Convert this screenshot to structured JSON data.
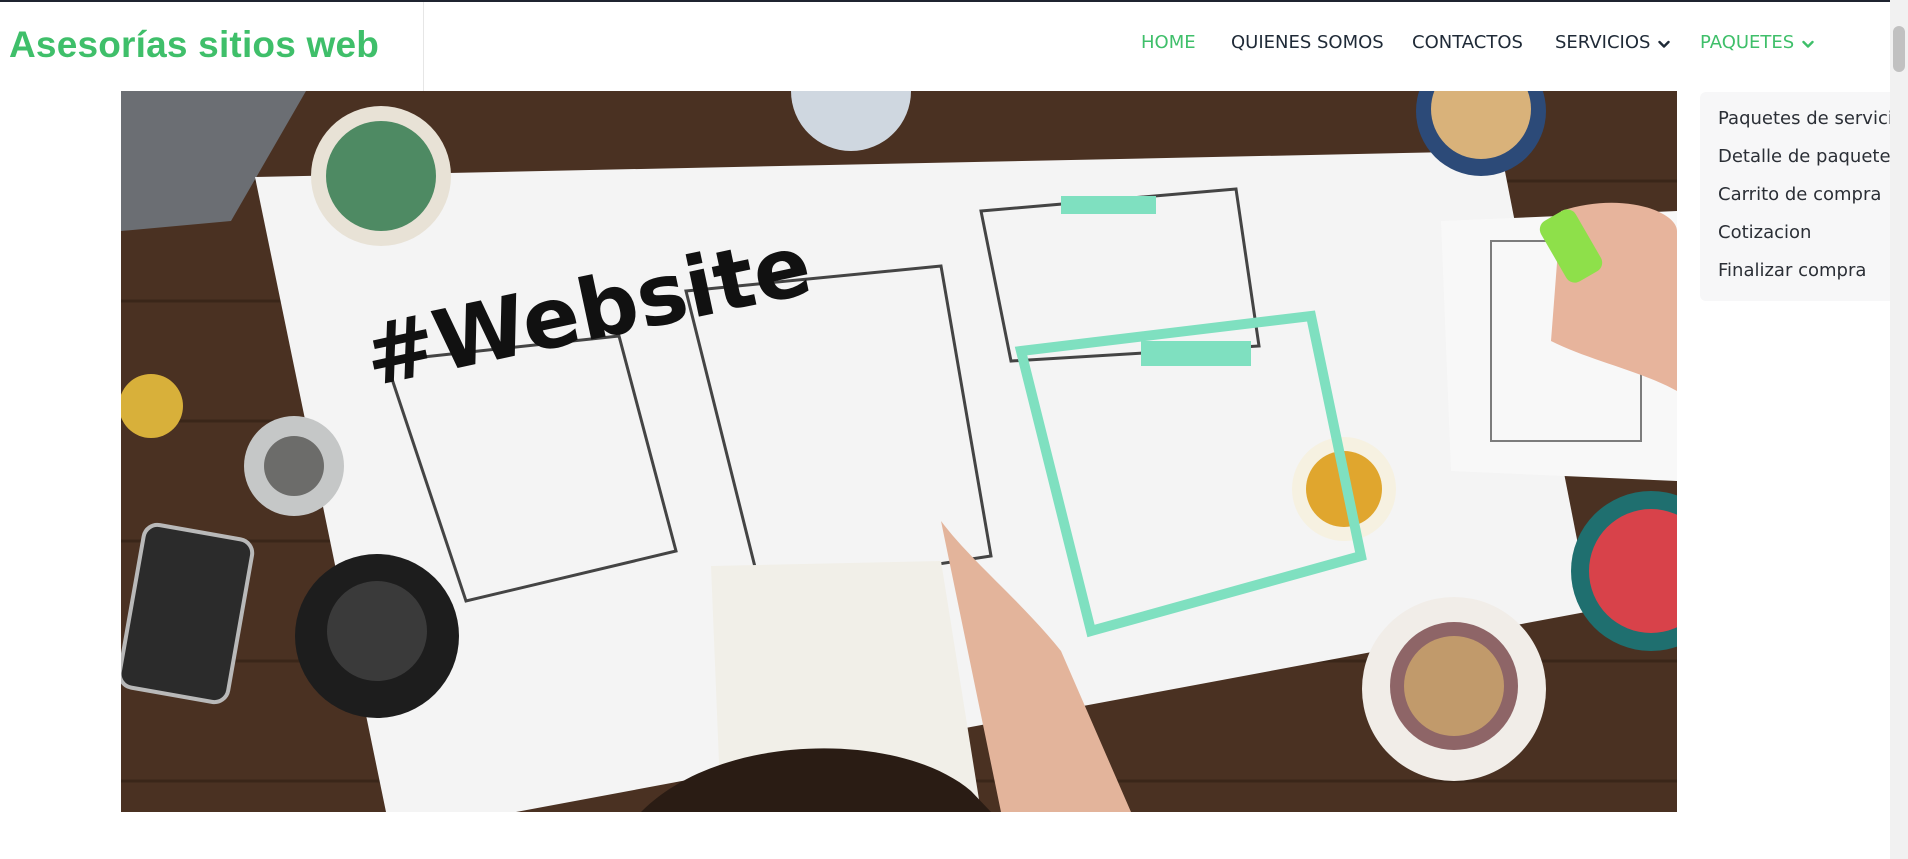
{
  "site": {
    "brand": "Asesorías sitios web"
  },
  "nav": {
    "home": "HOME",
    "about": "QUIENES SOMOS",
    "contacts": "CONTACTOS",
    "services": "SERVICIOS",
    "packages": "PAQUETES"
  },
  "packages_menu": {
    "items": [
      "Paquetes de servicios",
      "Detalle de paquetes",
      "Carrito de compra",
      "Cotizacion",
      "Finalizar compra"
    ]
  },
  "hero": {
    "image": "hero-photo",
    "headline": "#Website"
  },
  "colors": {
    "accent": "#3fbf6a",
    "nav_text": "#1f2a37",
    "table_wood": "#4a3122",
    "paper": "#f4f4f4",
    "mint": "#7fe0c0"
  },
  "icons": {
    "services_chevron": "chevron-down-icon",
    "packages_chevron": "chevron-down-icon"
  }
}
